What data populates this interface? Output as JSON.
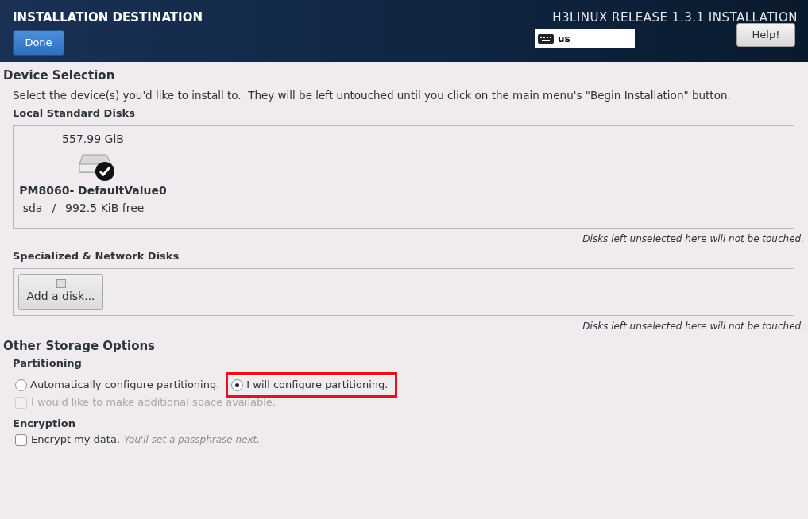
{
  "header": {
    "title": "INSTALLATION DESTINATION",
    "done_button": "Done",
    "product": "H3LINUX RELEASE 1.3.1 INSTALLATION",
    "keyboard_layout": "us",
    "help_button": "Help!"
  },
  "device_selection": {
    "heading": "Device Selection",
    "intro": "Select the device(s) you'd like to install to.  They will be left untouched until you click on the main menu's \"Begin Installation\" button.",
    "local_disks": {
      "label": "Local Standard Disks",
      "disks": [
        {
          "size": "557.99 GiB",
          "name": "PM8060- DefaultValue0",
          "device": "sda",
          "separator": "/",
          "free": "992.5 KiB free",
          "selected": true
        }
      ],
      "note": "Disks left unselected here will not be touched."
    },
    "network_disks": {
      "label": "Specialized & Network Disks",
      "add_button": "Add a disk...",
      "note": "Disks left unselected here will not be touched."
    }
  },
  "other_storage": {
    "heading": "Other Storage Options",
    "partitioning": {
      "label": "Partitioning",
      "options": [
        {
          "label": "Automatically configure partitioning.",
          "selected": false,
          "highlighted": false
        },
        {
          "label": "I will configure partitioning.",
          "selected": true,
          "highlighted": true
        }
      ],
      "extra_space": {
        "label": "I would like to make additional space available.",
        "checked": false,
        "disabled": true
      }
    },
    "encryption": {
      "label": "Encryption",
      "checkbox": {
        "label": "Encrypt my data.",
        "hint": "You'll set a passphrase next.",
        "checked": false,
        "disabled": false
      }
    }
  }
}
